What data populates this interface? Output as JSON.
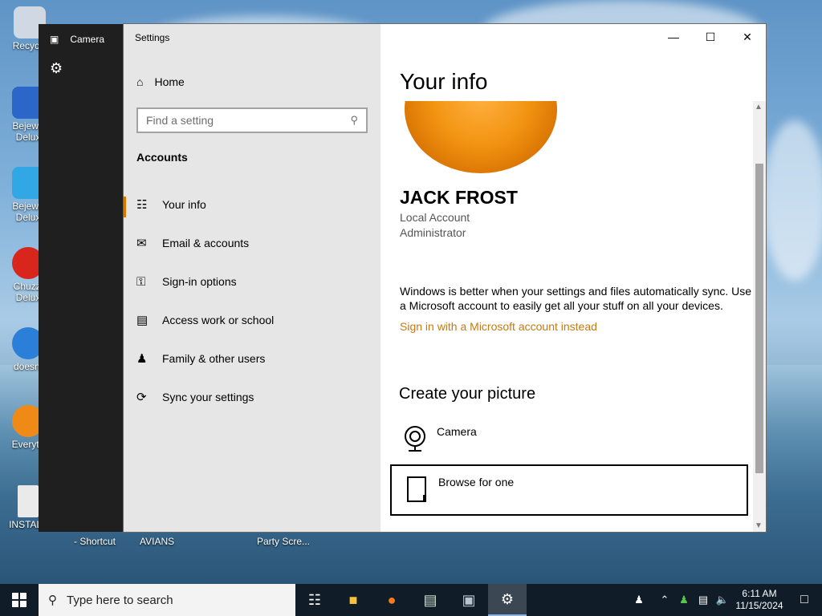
{
  "desktop": {
    "icons": [
      {
        "label": "Recycle",
        "color": "#cfd8e3"
      },
      {
        "label": "Bejewe Delux",
        "color": "#2c66c8"
      },
      {
        "label": "Bejewe Delux",
        "color": "#31a7e6"
      },
      {
        "label": "Chuzzl Delux",
        "color": "#d8261c"
      },
      {
        "label": "doesnt",
        "color": "#2b7fd8"
      },
      {
        "label": "Everyth",
        "color": "#f08a17"
      },
      {
        "label": "INSTALL",
        "color": "#eaeaea"
      }
    ],
    "bottom_labels": [
      "- Shortcut",
      "AVIANS",
      "Party Scre..."
    ]
  },
  "camera_window": {
    "title": "Camera",
    "camera_icon": "camera-icon",
    "settings_icon": "gear-icon"
  },
  "settings": {
    "app_title": "Settings",
    "home_label": "Home",
    "search_placeholder": "Find a setting",
    "section": "Accounts",
    "nav": [
      {
        "label": "Your info",
        "icon": "person-card-icon",
        "active": true
      },
      {
        "label": "Email & accounts",
        "icon": "mail-icon",
        "active": false
      },
      {
        "label": "Sign-in options",
        "icon": "key-icon",
        "active": false
      },
      {
        "label": "Access work or school",
        "icon": "briefcase-icon",
        "active": false
      },
      {
        "label": "Family & other users",
        "icon": "person-add-icon",
        "active": false
      },
      {
        "label": "Sync your settings",
        "icon": "sync-icon",
        "active": false
      }
    ],
    "content": {
      "title": "Your info",
      "user_name": "JACK FROST",
      "account_type": "Local Account",
      "role": "Administrator",
      "sync_text": "Windows is better when your settings and files automatically sync. Use a Microsoft account to easily get all your stuff on all your devices.",
      "signin_link": "Sign in with a Microsoft account instead",
      "create_picture_title": "Create your picture",
      "option_camera": "Camera",
      "option_browse": "Browse for one"
    },
    "colors": {
      "accent": "#d67a00",
      "link": "#c57a10"
    }
  },
  "taskbar": {
    "search_placeholder": "Type here to search",
    "time": "6:11 AM",
    "date": "11/15/2024"
  }
}
